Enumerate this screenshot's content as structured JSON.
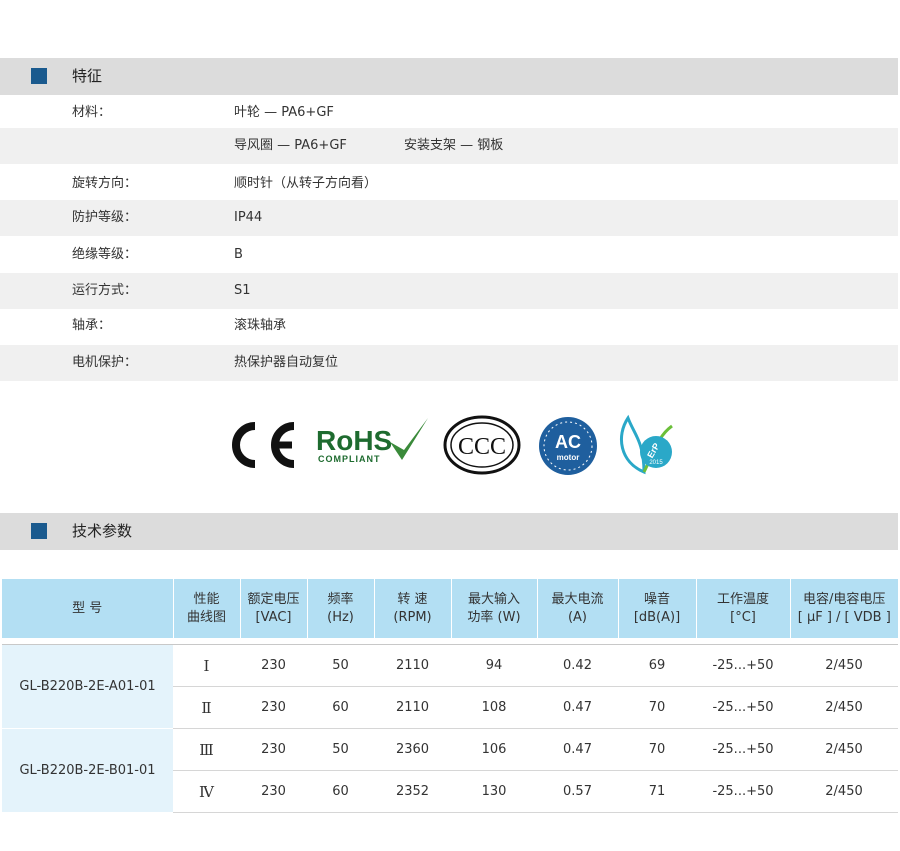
{
  "features": {
    "title": "特征",
    "rows": [
      {
        "label": "材料：",
        "value": "叶轮 — PA6+GF",
        "value2": ""
      },
      {
        "label": "",
        "value": "导风圈 — PA6+GF",
        "value2": "安装支架 — 钢板"
      },
      {
        "label": "旋转方向：",
        "value": "顺时针（从转子方向看）",
        "value2": ""
      },
      {
        "label": "防护等级：",
        "value": "IP44",
        "value2": ""
      },
      {
        "label": "绝缘等级：",
        "value": "B",
        "value2": ""
      },
      {
        "label": "运行方式：",
        "value": "S1",
        "value2": ""
      },
      {
        "label": "轴承：",
        "value": "滚珠轴承",
        "value2": ""
      },
      {
        "label": "电机保护：",
        "value": "热保护器自动复位",
        "value2": ""
      }
    ]
  },
  "logos": {
    "ce": "CE",
    "rohs": "RoHS",
    "rohs_sub": "COMPLIANT",
    "ccc": "CCC",
    "ac": "AC",
    "ac_sub": "motor",
    "erp": "ErP",
    "erp_year": "2015",
    "colors": {
      "ce": "#111111",
      "rohs": "#1e6b2f",
      "ccc": "#111111",
      "ac": "#1f5f9e",
      "erp": "#2aa8c8"
    }
  },
  "specs": {
    "title": "技术参数",
    "headers": [
      {
        "line1": "型 号",
        "line2": ""
      },
      {
        "line1": "性能",
        "line2": "曲线图"
      },
      {
        "line1": "额定电压",
        "line2": "[VAC]"
      },
      {
        "line1": "频率",
        "line2": "(Hz)"
      },
      {
        "line1": "转 速",
        "line2": "(RPM)"
      },
      {
        "line1": "最大输入",
        "line2": "功率 (W)"
      },
      {
        "line1": "最大电流",
        "line2": "(A)"
      },
      {
        "line1": "噪音",
        "line2": "[dB(A)]"
      },
      {
        "line1": "工作温度",
        "line2": "[°C]"
      },
      {
        "line1": "电容/电容电压",
        "line2": "[ μF ] / [ VDB ]"
      }
    ],
    "models": [
      {
        "name": "GL-B220B-2E-A01-01",
        "rows": [
          {
            "curve": "Ⅰ",
            "voltage": "230",
            "freq": "50",
            "rpm": "2110",
            "power": "94",
            "current": "0.42",
            "noise": "69",
            "temp": "-25...+50",
            "cap": "2/450"
          },
          {
            "curve": "Ⅱ",
            "voltage": "230",
            "freq": "60",
            "rpm": "2110",
            "power": "108",
            "current": "0.47",
            "noise": "70",
            "temp": "-25...+50",
            "cap": "2/450"
          }
        ]
      },
      {
        "name": "GL-B220B-2E-B01-01",
        "rows": [
          {
            "curve": "Ⅲ",
            "voltage": "230",
            "freq": "50",
            "rpm": "2360",
            "power": "106",
            "current": "0.47",
            "noise": "70",
            "temp": "-25...+50",
            "cap": "2/450"
          },
          {
            "curve": "Ⅳ",
            "voltage": "230",
            "freq": "60",
            "rpm": "2352",
            "power": "130",
            "current": "0.57",
            "noise": "71",
            "temp": "-25...+50",
            "cap": "2/450"
          }
        ]
      }
    ]
  }
}
